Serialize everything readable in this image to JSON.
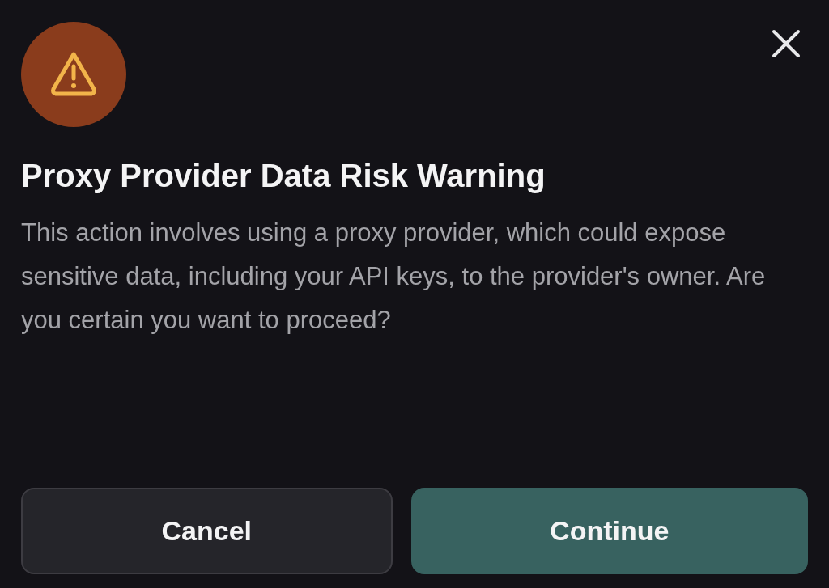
{
  "dialog": {
    "title": "Proxy Provider Data Risk Warning",
    "message": "This action involves using a proxy provider, which could expose sensitive data, including your API keys, to the provider's owner. Are you certain you want to proceed?",
    "buttons": [
      {
        "label": "Cancel",
        "kind": "secondary"
      },
      {
        "label": "Continue",
        "kind": "primary"
      }
    ]
  }
}
